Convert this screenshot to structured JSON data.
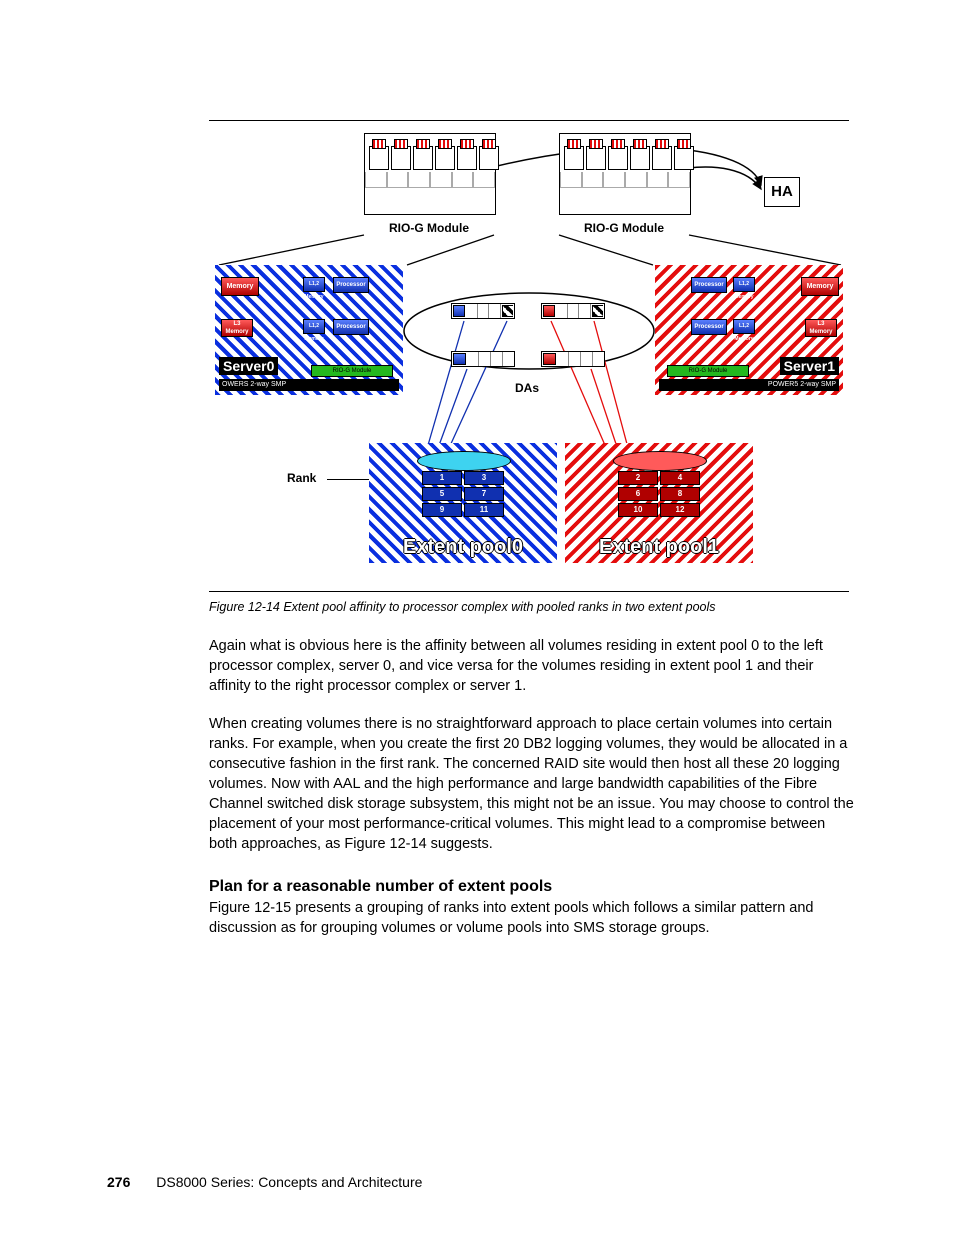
{
  "figure": {
    "riog_label": "RIO-G Module",
    "ha_label": "HA",
    "das_label": "DAs",
    "rank_label": "Rank",
    "server0": {
      "name": "Server0",
      "smp": "OWERS 2-way SMP",
      "rio": "RIO-G Module",
      "memory": "Memory",
      "processor": "Processor",
      "l12": "L1,2 Memory",
      "l3": "L3 Memory"
    },
    "server1": {
      "name": "Server1",
      "smp": "POWER5 2-way SMP",
      "rio": "RIO-G Module",
      "memory": "Memory",
      "processor": "Processor",
      "l12": "L1,2 Memory",
      "l3": "L3 Memory"
    },
    "pool0": {
      "label": "Extent pool0",
      "ranks": [
        "1",
        "3",
        "5",
        "7",
        "9",
        "11"
      ]
    },
    "pool1": {
      "label": "Extent pool1",
      "ranks": [
        "2",
        "4",
        "6",
        "8",
        "10",
        "12"
      ]
    }
  },
  "caption": "Figure 12-14   Extent pool affinity to processor complex with pooled ranks in two extent pools",
  "para1": "Again what is obvious here is the affinity between all volumes residing in extent pool 0 to the left processor complex, server 0, and vice versa for the volumes residing in extent pool 1 and their affinity to the right processor complex or server 1.",
  "para2": "When creating volumes there is no straightforward approach to place certain volumes into certain ranks. For example, when you create the first 20 DB2 logging volumes, they would be allocated in a consecutive fashion in the first rank. The concerned RAID site would then host all these 20 logging volumes. Now with AAL and the high performance and large bandwidth capabilities of the Fibre Channel switched disk storage subsystem, this might not be an issue. You may choose to control the placement of your most performance-critical volumes. This might lead to a compromise between both approaches, as Figure 12-14 suggests.",
  "heading": "Plan for a reasonable number of extent pools",
  "para3": "Figure 12-15 presents a grouping of ranks into extent pools which follows a similar pattern and discussion as for grouping volumes or volume pools into SMS storage groups.",
  "footer": {
    "pageno": "276",
    "title": "DS8000 Series: Concepts and Architecture"
  }
}
